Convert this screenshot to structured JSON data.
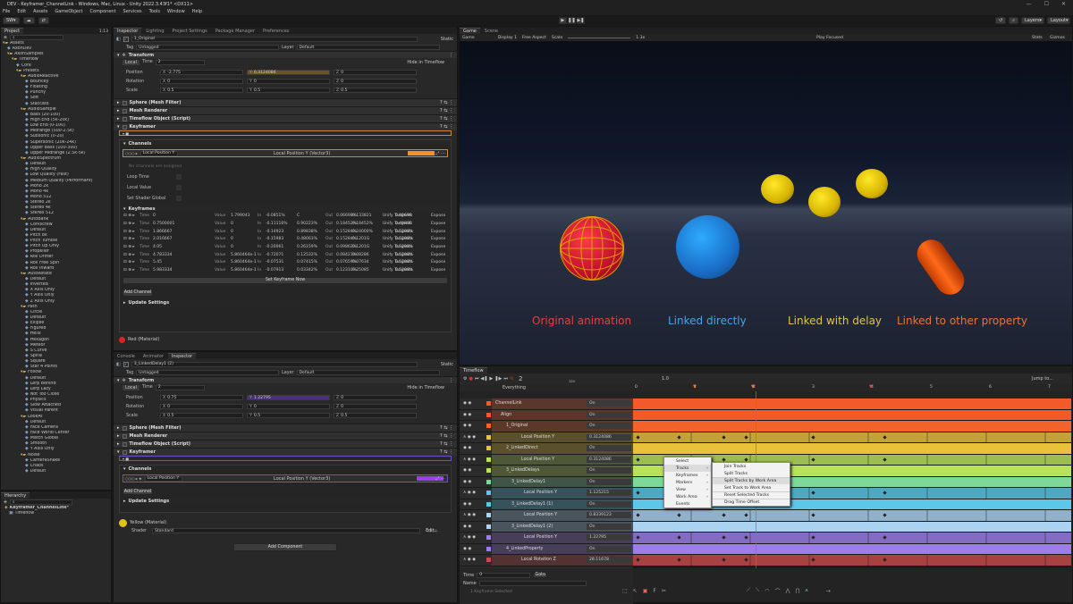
{
  "window": {
    "title": "DEV - Keyframer_ChannelLink - Windows, Mac, Linux - Unity 2022.3.43f1* <DX11>"
  },
  "menu": [
    "File",
    "Edit",
    "Assets",
    "GameObject",
    "Component",
    "Services",
    "Tools",
    "Window",
    "Help"
  ],
  "toolbar": {
    "account": "SW",
    "layers": "Layers",
    "layout": "Layout"
  },
  "project": {
    "tab": "Project",
    "slider": "1:13",
    "items": [
      {
        "t": "Assets",
        "d": 0
      },
      {
        "t": "AxonDev",
        "d": 1
      },
      {
        "t": "AxonSamples",
        "d": 1
      },
      {
        "t": "Timeflow",
        "d": 2
      },
      {
        "t": "Core",
        "d": 3
      },
      {
        "t": "Presets",
        "d": 3
      },
      {
        "t": "AudioReactive",
        "d": 4
      },
      {
        "t": "Bouncey",
        "d": 5
      },
      {
        "t": "Floating",
        "d": 5
      },
      {
        "t": "Punchy",
        "d": 5
      },
      {
        "t": "Soft",
        "d": 5
      },
      {
        "t": "Staccato",
        "d": 5
      },
      {
        "t": "AudioSample",
        "d": 4
      },
      {
        "t": "Bass (20-100)",
        "d": 5
      },
      {
        "t": "High End (5k-20k)",
        "d": 5
      },
      {
        "t": "Low End (0-100)",
        "d": 5
      },
      {
        "t": "Midrange (500-2.5k)",
        "d": 5
      },
      {
        "t": "Subsonic (0-20)",
        "d": 5
      },
      {
        "t": "Supersonic (20k-24k)",
        "d": 5
      },
      {
        "t": "Upper Bass (100-300)",
        "d": 5
      },
      {
        "t": "Upper Midrange (2.5k-5k)",
        "d": 5
      },
      {
        "t": "AudioSpectrum",
        "d": 4
      },
      {
        "t": "Default",
        "d": 5
      },
      {
        "t": "High Quality",
        "d": 5
      },
      {
        "t": "Low Quality (Fast)",
        "d": 5
      },
      {
        "t": "Medium Quality (Performant)",
        "d": 5
      },
      {
        "t": "Mono 2k",
        "d": 5
      },
      {
        "t": "Mono 4k",
        "d": 5
      },
      {
        "t": "Mono 512",
        "d": 5
      },
      {
        "t": "Stereo 2k",
        "d": 5
      },
      {
        "t": "Stereo 4k",
        "d": 5
      },
      {
        "t": "Stereo 512",
        "d": 5
      },
      {
        "t": "AutoBank",
        "d": 4
      },
      {
        "t": "Corkscrew",
        "d": 5
      },
      {
        "t": "Default",
        "d": 5
      },
      {
        "t": "Pitch 8k",
        "d": 5
      },
      {
        "t": "Pitch Tumble",
        "d": 5
      },
      {
        "t": "Pitch Up Only",
        "d": 5
      },
      {
        "t": "Propeller",
        "d": 5
      },
      {
        "t": "Roll Drifter",
        "d": 5
      },
      {
        "t": "Roll Free Spin",
        "d": 5
      },
      {
        "t": "Roll Inward",
        "d": 5
      },
      {
        "t": "AutoRotate",
        "d": 4
      },
      {
        "t": "Default",
        "d": 5
      },
      {
        "t": "Inverted",
        "d": 5
      },
      {
        "t": "X Axis Only",
        "d": 5
      },
      {
        "t": "Y Axis Only",
        "d": 5
      },
      {
        "t": "Z Axis Only",
        "d": 5
      },
      {
        "t": "Path",
        "d": 4
      },
      {
        "t": "Circle",
        "d": 5
      },
      {
        "t": "Default",
        "d": 5
      },
      {
        "t": "Ellipse",
        "d": 5
      },
      {
        "t": "Figure8",
        "d": 5
      },
      {
        "t": "Helix",
        "d": 5
      },
      {
        "t": "Hexagon",
        "d": 5
      },
      {
        "t": "Meteor",
        "d": 5
      },
      {
        "t": "S Curve",
        "d": 5
      },
      {
        "t": "Spiral",
        "d": 5
      },
      {
        "t": "Square",
        "d": 5
      },
      {
        "t": "Star 4 Points",
        "d": 5
      },
      {
        "t": "Follow",
        "d": 4
      },
      {
        "t": "Default",
        "d": 5
      },
      {
        "t": "Lerp Behind",
        "d": 5
      },
      {
        "t": "Lerp Lazy",
        "d": 5
      },
      {
        "t": "Not Too Close",
        "d": 5
      },
      {
        "t": "Physics",
        "d": 5
      },
      {
        "t": "Slow Attached",
        "d": 5
      },
      {
        "t": "Visual Parent",
        "d": 5
      },
      {
        "t": "LookAt",
        "d": 4
      },
      {
        "t": "Default",
        "d": 5
      },
      {
        "t": "Face Camera",
        "d": 5
      },
      {
        "t": "Face World Center",
        "d": 5
      },
      {
        "t": "Match Global",
        "d": 5
      },
      {
        "t": "Smooth",
        "d": 5
      },
      {
        "t": "Y Axis Only",
        "d": 5
      },
      {
        "t": "Noise",
        "d": 4
      },
      {
        "t": "CameraShake",
        "d": 5
      },
      {
        "t": "Chaos",
        "d": 5
      },
      {
        "t": "Default",
        "d": 5
      }
    ]
  },
  "hierarchy": {
    "tab": "Hierarchy",
    "scene": "Keyframer_ChannelLink*",
    "items": [
      {
        "t": "Timeflow",
        "d": 1
      },
      {
        "t": "Readme",
        "d": 2
      },
      {
        "t": "Main Camera",
        "d": 2,
        "blue": true
      },
      {
        "t": "Directional Light",
        "d": 2,
        "blue": true
      },
      {
        "t": "ChannelLink",
        "d": 1
      },
      {
        "t": "Align",
        "d": 2
      },
      {
        "t": "1_Original",
        "d": 3
      },
      {
        "t": "2_LinkedDirect",
        "d": 3
      },
      {
        "t": "3_LinkedDelays",
        "d": 3
      },
      {
        "t": "3_LinkedDelay1",
        "d": 4
      },
      {
        "t": "3_LinkedDelay1 (1)",
        "d": 4
      },
      {
        "t": "3_LinkedDelay1 (2)",
        "d": 4
      },
      {
        "t": "4_LinkedProperty",
        "d": 3
      },
      {
        "t": "Labels",
        "d": 2
      },
      {
        "t": "Canvas",
        "d": 1
      }
    ]
  },
  "inspector1": {
    "tabs": [
      "Inspector",
      "Lighting",
      "Project Settings",
      "Package Manager",
      "Preferences"
    ],
    "name": "1_Original",
    "static": "Static",
    "tag": "Untagged",
    "layer": "Default",
    "transform": {
      "title": "Transform",
      "mode": "Local",
      "time": "2",
      "hide": "Hide in Timeflow",
      "position": {
        "x": "-2.775",
        "y": "0.3124086",
        "z": "0"
      },
      "rotation": {
        "x": "0",
        "y": "0",
        "z": "0"
      },
      "scale": {
        "x": "0.5",
        "y": "0.5",
        "z": "0.5"
      }
    },
    "labels": {
      "position": "Position",
      "rotation": "Rotation",
      "scale": "Scale"
    },
    "components": [
      "Sphere (Mesh Filter)",
      "Mesh Renderer",
      "Timeflow Object (Script)",
      "Keyframer"
    ],
    "channels": "Channels",
    "channel_name": "Local Position Y",
    "channel_type": "Local Position Y (Vector3)",
    "no_channels": "No channels are assigned",
    "loop": "Loop Time",
    "value": "Local Value",
    "shader": "Set Shader Global",
    "keyframes": "Keyframes",
    "kf": [
      {
        "time": "0",
        "value": "1.799043",
        "in": "-0.0851%",
        "c": "C",
        "out": "0.06698%",
        "o2": "0.133821",
        "o3": "0.80698"
      },
      {
        "time": "0.7500001",
        "value": "0",
        "in": "-0.11116%",
        "c": "0.90223%",
        "out": "0.18452%",
        "o2": "0.18452%",
        "o3": "0.4980E"
      },
      {
        "time": "1.866667",
        "value": "0",
        "in": "-0.14923",
        "c": "0.89838%",
        "out": "0.15284%",
        "o2": "0.24000%",
        "o3": "0.5208%"
      },
      {
        "time": "2.016667",
        "value": "0",
        "in": "-0.15983",
        "c": "0.48063%",
        "out": "0.15284%",
        "o2": "0.1201G",
        "o3": "0.5208%"
      },
      {
        "time": "4.05",
        "value": "0",
        "in": "-0.20061",
        "c": "0.26159%",
        "out": "0.09862%",
        "o2": "0.1201G",
        "o3": "0.5208%"
      },
      {
        "time": "4.783334",
        "value": "5.860464e-1",
        "in": "-0.72071",
        "c": "0.12532%",
        "out": "0.08421%",
        "o2": "0.08286",
        "o3": "0.5208%"
      },
      {
        "time": "5.45",
        "value": "5.860464e-1",
        "in": "-0.07531",
        "c": "0.07415%",
        "out": "0.07659%",
        "o2": "0.07634",
        "o3": "0.5208%"
      },
      {
        "time": "5.983334",
        "value": "5.860464e-1",
        "in": "-0.07913",
        "c": "0.03342%",
        "out": "0.12310%",
        "o2": "0.25085",
        "o3": "0.5208%"
      }
    ],
    "unify": "Unify Tangents",
    "expose": "Expose",
    "set_kf": "Set Keyframe Now",
    "add_channel": "Add Channel",
    "update": "Update Settings",
    "material": "Red (Material)"
  },
  "inspector2": {
    "tabs": [
      "Console",
      "Animator",
      "Inspector"
    ],
    "name": "3_LinkedDelay1 (2)",
    "static": "Static",
    "tag": "Untagged",
    "layer": "Default",
    "transform": {
      "title": "Transform",
      "mode": "Local",
      "time": "2",
      "hide": "Hide in Timeflow",
      "position": {
        "x": "0.75",
        "y": "1.22795",
        "z": "0"
      },
      "rotation": {
        "x": "0",
        "y": "0",
        "z": "0"
      },
      "scale": {
        "x": "0.5",
        "y": "0.5",
        "z": "0.5"
      }
    },
    "components": [
      "Sphere (Mesh Filter)",
      "Mesh Renderer",
      "Timeflow Object (Script)",
      "Keyframer"
    ],
    "channels": "Channels",
    "channel_name": "Local Position Y",
    "channel_type": "Local Position Y (Vector3)",
    "add_channel": "Add Channel",
    "update": "Update Settings",
    "material": "Yellow (Material)",
    "shader_label": "Shader",
    "shader": "Standard",
    "edit": "Edit...",
    "add_component": "Add Component"
  },
  "scene": {
    "tabs": [
      "Game",
      "Scene"
    ],
    "display": "Display 1",
    "aspect": "Free Aspect",
    "scale_label": "Scale",
    "scale": "1.3x",
    "play": "Play Focused",
    "stats": "Stats",
    "gizmos": "Gizmos",
    "captions": [
      {
        "t": "Original animation",
        "color": "#e0443e"
      },
      {
        "t": "Linked directly",
        "color": "#4aa3e8"
      },
      {
        "t": "Linked with delay",
        "color": "#e0c44a"
      },
      {
        "t": "Linked to other property",
        "color": "#e8743a"
      }
    ]
  },
  "timeline": {
    "tab": "Timeflow",
    "frame": "2",
    "frame_sub": "120",
    "speed": "1.0",
    "jump": "Jump to...",
    "root": "Everything",
    "ruler": [
      "0",
      "1",
      "2",
      "3",
      "4",
      "5",
      "6",
      "7"
    ],
    "tracks": [
      {
        "name": "ChannelLink",
        "val": "On",
        "color": "#f25a2a",
        "type": "obj",
        "indent": 0
      },
      {
        "name": "Align",
        "val": "On",
        "color": "#f25a2a",
        "type": "obj",
        "indent": 1
      },
      {
        "name": "1_Original",
        "val": "On",
        "color": "#f2622a",
        "type": "obj",
        "indent": 2
      },
      {
        "name": "Local Position Y",
        "val": "0.3124086",
        "color": "#e8c23a",
        "type": "chan",
        "indent": 3
      },
      {
        "name": "2_LinkedDirect",
        "val": "On",
        "color": "#e8c23a",
        "type": "obj",
        "indent": 2
      },
      {
        "name": "Local Position Y",
        "val": "0.3124086",
        "color": "#b9e25c",
        "type": "chan",
        "indent": 3
      },
      {
        "name": "3_LinkedDelays",
        "val": "On",
        "color": "#b9e25c",
        "type": "obj",
        "indent": 2
      },
      {
        "name": "3_LinkedDelay1",
        "val": "On",
        "color": "#7ed89a",
        "type": "obj",
        "indent": 3
      },
      {
        "name": "Local Position Y",
        "val": "1.125215",
        "color": "#5cc7e8",
        "type": "chan",
        "indent": 4
      },
      {
        "name": "3_LinkedDelay1 (1)",
        "val": "On",
        "color": "#5cc7e8",
        "type": "obj",
        "indent": 3
      },
      {
        "name": "Local Position Y",
        "val": "0.8339123",
        "color": "#a9d3f0",
        "type": "chan",
        "indent": 4
      },
      {
        "name": "3_LinkedDelay1 (2)",
        "val": "On",
        "color": "#a9d3f0",
        "type": "obj",
        "indent": 3
      },
      {
        "name": "Local Position Y",
        "val": "1.22795",
        "color": "#9c7ee8",
        "type": "chan",
        "indent": 4
      },
      {
        "name": "4_LinkedProperty",
        "val": "On",
        "color": "#9c7ee8",
        "type": "obj",
        "indent": 2
      },
      {
        "name": "Local Rotation Z",
        "val": "28.11678",
        "color": "#c84a4a",
        "type": "chan",
        "indent": 3
      }
    ],
    "footer": {
      "time_label": "Time",
      "time": "0",
      "goto": "Goto",
      "name_label": "Name",
      "selected": "1 Keyframe Selected"
    },
    "context_menu": [
      "Select",
      "Tracks",
      "Keyframes",
      "Markers",
      "View",
      "Work Area",
      "Events"
    ],
    "submenu": [
      "Join Tracks",
      "Split Tracks",
      "Split Tracks by Work Area",
      "Set Track to Work Area",
      "Reset Selected Tracks",
      "Drag Time Offset"
    ]
  }
}
